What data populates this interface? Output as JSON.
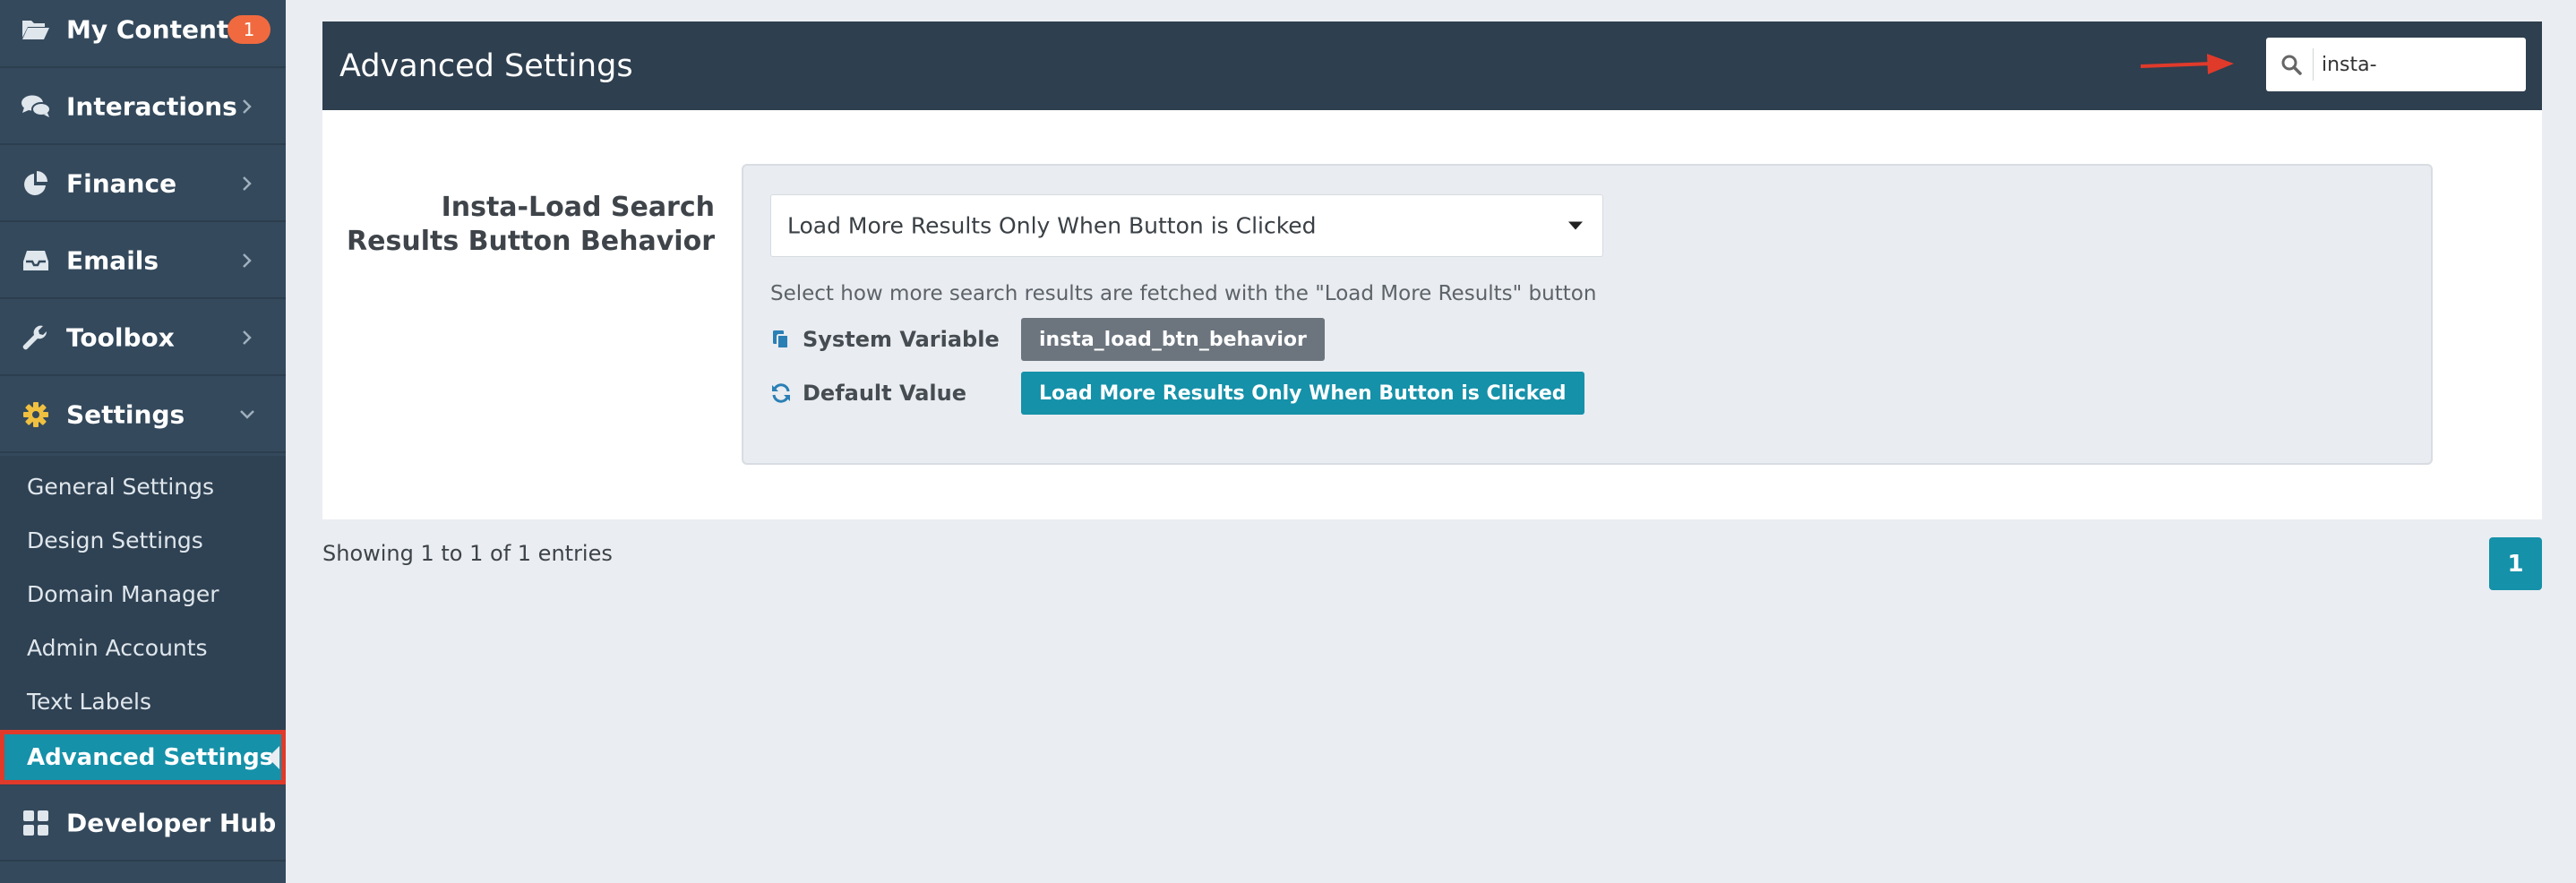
{
  "sidebar": {
    "items": [
      {
        "label": "My Content",
        "icon": "folder-open-icon",
        "badge": "1"
      },
      {
        "label": "Interactions",
        "icon": "comments-icon"
      },
      {
        "label": "Finance",
        "icon": "pie-chart-icon"
      },
      {
        "label": "Emails",
        "icon": "inbox-icon"
      },
      {
        "label": "Toolbox",
        "icon": "wrench-icon"
      },
      {
        "label": "Settings",
        "icon": "gear-icon",
        "expanded": true
      },
      {
        "label": "Developer Hub",
        "icon": "grid-icon"
      }
    ],
    "settings_sub": [
      {
        "label": "General Settings"
      },
      {
        "label": "Design Settings"
      },
      {
        "label": "Domain Manager"
      },
      {
        "label": "Admin Accounts"
      },
      {
        "label": "Text Labels"
      },
      {
        "label": "Advanced Settings",
        "active": true
      }
    ]
  },
  "header": {
    "title": "Advanced Settings",
    "search_value": "insta-"
  },
  "setting": {
    "label": "Insta-Load Search Results Button Behavior",
    "selected_option": "Load More Results Only When Button is Clicked",
    "help": "Select how more search results are fetched with the \"Load More Results\" button",
    "system_variable_label": "System Variable",
    "system_variable_value": "insta_load_btn_behavior",
    "default_value_label": "Default Value",
    "default_value": "Load More Results Only When Button is Clicked"
  },
  "footer": {
    "entries_text": "Showing 1 to 1 of 1 entries",
    "current_page": "1"
  },
  "colors": {
    "sidebar_bg": "#34495c",
    "accent": "#1591a9",
    "highlight": "#e03a2b",
    "badge": "#f16a3f"
  }
}
